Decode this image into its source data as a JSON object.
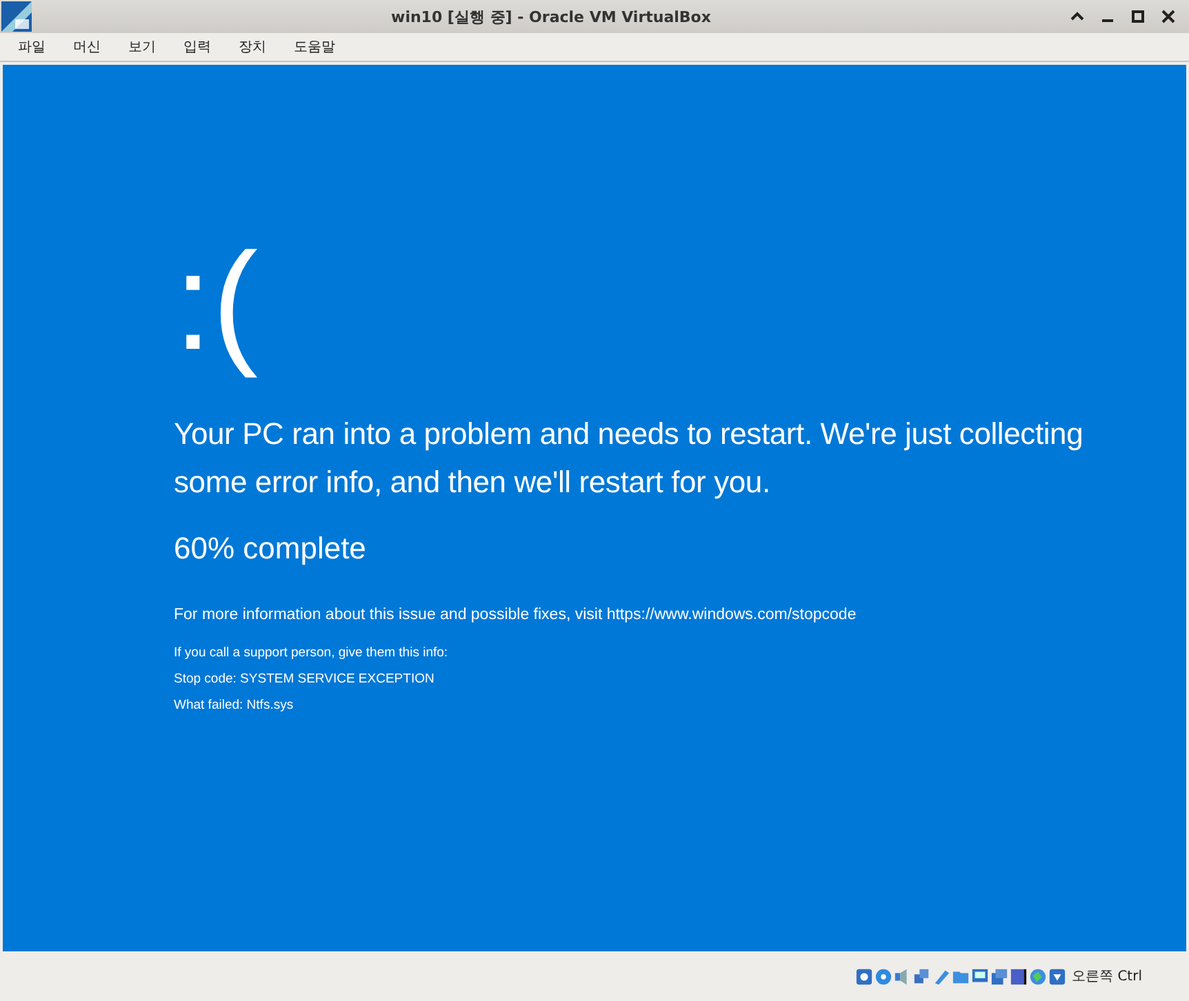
{
  "window": {
    "title": "win10 [실행 중] - Oracle VM VirtualBox"
  },
  "menu": [
    "파일",
    "머신",
    "보기",
    "입력",
    "장치",
    "도움말"
  ],
  "screen": {
    "face": ":(",
    "message": "Your PC ran into a problem and needs to restart. We're just collecting some error info, and then we'll restart for you.",
    "progress": "60% complete",
    "info": "For more information about this issue and possible fixes, visit https://www.windows.com/stopcode",
    "details": [
      "If you call a support person, give them this info:",
      "Stop code: SYSTEM SERVICE EXCEPTION",
      "What failed: Ntfs.sys"
    ]
  },
  "status_bar": {
    "host_key": "오른쪽 Ctrl"
  }
}
